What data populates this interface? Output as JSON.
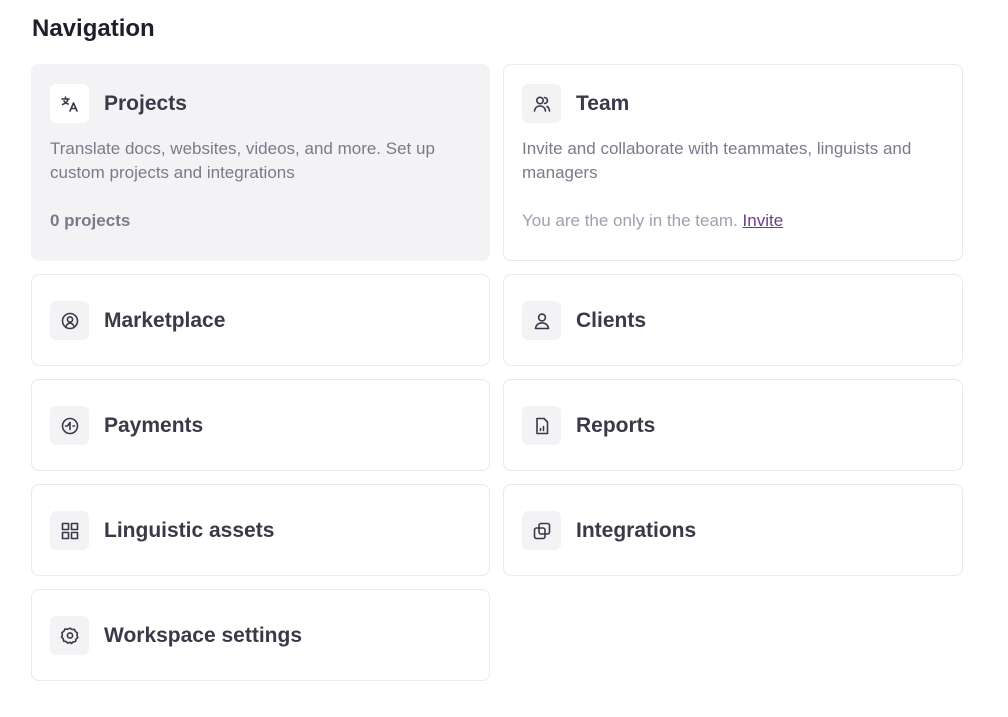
{
  "page": {
    "heading": "Navigation"
  },
  "colors": {
    "accent_link": "#6d3b8f",
    "active_card_bg": "#f3f3f6",
    "border": "#e9e9ee"
  },
  "cards": {
    "projects": {
      "title": "Projects",
      "icon": "translate-icon",
      "description": "Translate docs, websites, videos, and more. Set up custom projects and integrations",
      "meta": "0 projects",
      "active": true
    },
    "team": {
      "title": "Team",
      "icon": "users-icon",
      "description": "Invite and collaborate with teammates, linguists and managers",
      "meta": "You are the only in the team.",
      "link": "Invite"
    },
    "marketplace": {
      "title": "Marketplace",
      "icon": "search-person-icon"
    },
    "clients": {
      "title": "Clients",
      "icon": "user-icon"
    },
    "payments": {
      "title": "Payments",
      "icon": "payment-icon"
    },
    "reports": {
      "title": "Reports",
      "icon": "report-icon"
    },
    "linguistic_assets": {
      "title": "Linguistic assets",
      "icon": "grid-icon"
    },
    "integrations": {
      "title": "Integrations",
      "icon": "integrations-icon"
    },
    "workspace_settings": {
      "title": "Workspace settings",
      "icon": "gear-icon"
    }
  }
}
